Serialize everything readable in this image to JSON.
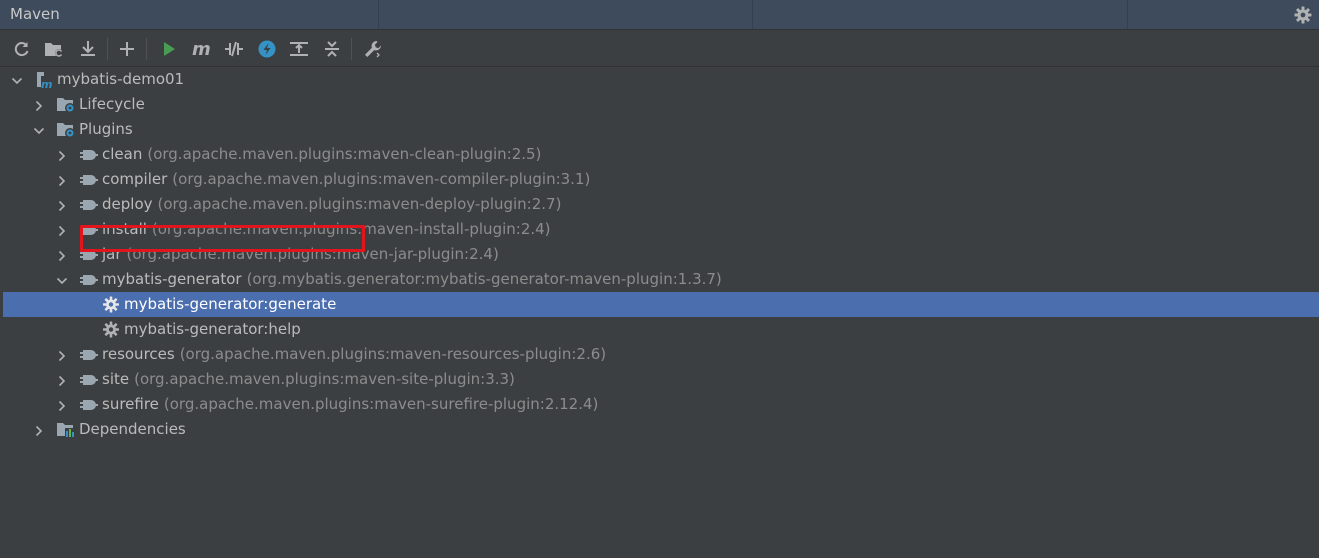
{
  "header": {
    "title": "Maven"
  },
  "toolbar": {
    "buttons": [
      {
        "name": "reload-all-icon"
      },
      {
        "name": "generate-sources-icon"
      },
      {
        "name": "download-sources-icon"
      },
      {
        "name": "add-maven-project-icon"
      },
      {
        "name": "run-maven-build-icon"
      },
      {
        "name": "execute-maven-goal-icon"
      },
      {
        "name": "toggle-offline-mode-icon"
      },
      {
        "name": "skip-tests-icon"
      },
      {
        "name": "show-dependencies-icon"
      },
      {
        "name": "collapse-all-icon"
      },
      {
        "name": "build-tool-settings-icon"
      }
    ]
  },
  "tree": {
    "project": "mybatis-demo01",
    "lifecycle": "Lifecycle",
    "plugins": "Plugins",
    "dependencies": "Dependencies",
    "plugin_items": [
      {
        "name": "clean",
        "coord": "(org.apache.maven.plugins:maven-clean-plugin:2.5)"
      },
      {
        "name": "compiler",
        "coord": "(org.apache.maven.plugins:maven-compiler-plugin:3.1)"
      },
      {
        "name": "deploy",
        "coord": "(org.apache.maven.plugins:maven-deploy-plugin:2.7)"
      },
      {
        "name": "install",
        "coord": "(org.apache.maven.plugins:maven-install-plugin:2.4)"
      },
      {
        "name": "jar",
        "coord": "(org.apache.maven.plugins:maven-jar-plugin:2.4)"
      },
      {
        "name": "mybatis-generator",
        "coord": "(org.mybatis.generator:mybatis-generator-maven-plugin:1.3.7)"
      },
      {
        "name": "resources",
        "coord": "(org.apache.maven.plugins:maven-resources-plugin:2.6)"
      },
      {
        "name": "site",
        "coord": "(org.apache.maven.plugins:maven-site-plugin:3.3)"
      },
      {
        "name": "surefire",
        "coord": "(org.apache.maven.plugins:maven-surefire-plugin:2.12.4)"
      }
    ],
    "goals": [
      {
        "label": "mybatis-generator:generate",
        "selected": true
      },
      {
        "label": "mybatis-generator:help",
        "selected": false
      }
    ]
  },
  "colors": {
    "background": "#3c3f41",
    "header": "#3d4b5c",
    "selection": "#4b6eaf",
    "highlight_box": "#e2151d",
    "run_green": "#499c54",
    "accent_blue": "#3592c4"
  }
}
